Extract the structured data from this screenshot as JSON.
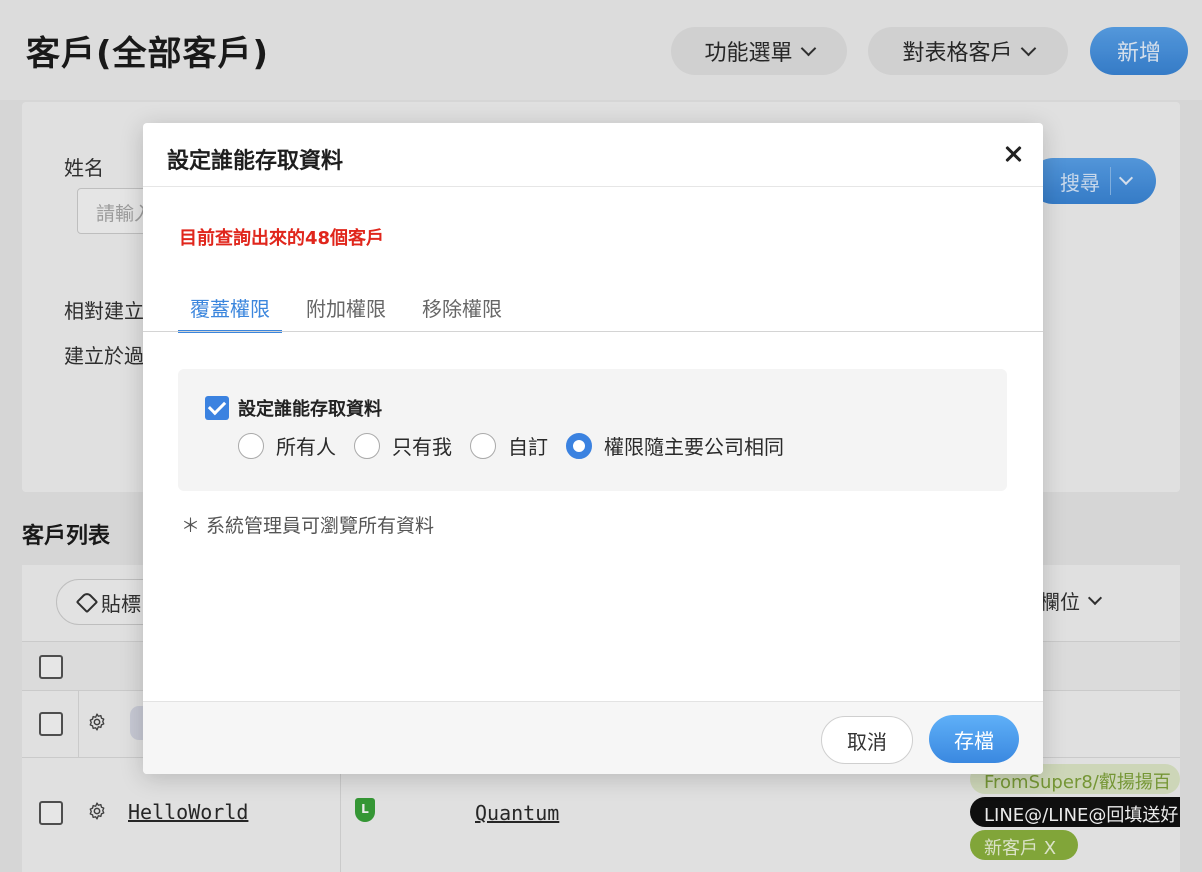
{
  "page": {
    "title": "客戶(全部客戶)",
    "function_menu_label": "功能選單",
    "table_customers_label": "對表格客戶",
    "new_label": "新增"
  },
  "filters": {
    "name_label": "姓名",
    "name_placeholder": "請輸入",
    "relative_created_label": "相對建立",
    "created_at_label": "建立於過",
    "search_label": "搜尋"
  },
  "list": {
    "title": "客戶列表",
    "tag_button_label": "貼標",
    "columns_button_label": "欄位",
    "rows": [
      {
        "name": "HelloWorld",
        "shield_letter": "L",
        "company": "Quantum",
        "tags": [
          "FromSuper8/叡揚揚百",
          "LINE@/LINE@回填送好",
          "新客戶 X"
        ]
      }
    ]
  },
  "modal": {
    "title": "設定誰能存取資料",
    "count_text": "目前查詢出來的48個客戶",
    "tabs": [
      "覆蓋權限",
      "附加權限",
      "移除權限"
    ],
    "active_tab": "覆蓋權限",
    "checkbox_label": "設定誰能存取資料",
    "checkbox_checked": true,
    "radio_options": [
      "所有人",
      "只有我",
      "自訂",
      "權限隨主要公司相同"
    ],
    "radio_selected": "權限隨主要公司相同",
    "note": "＊ 系統管理員可瀏覽所有資料",
    "cancel_label": "取消",
    "save_label": "存檔"
  },
  "colors": {
    "accent": "#3b86dd",
    "alert": "#e0261c",
    "tag_green": "#7fae2e",
    "tag_black": "#111111"
  }
}
